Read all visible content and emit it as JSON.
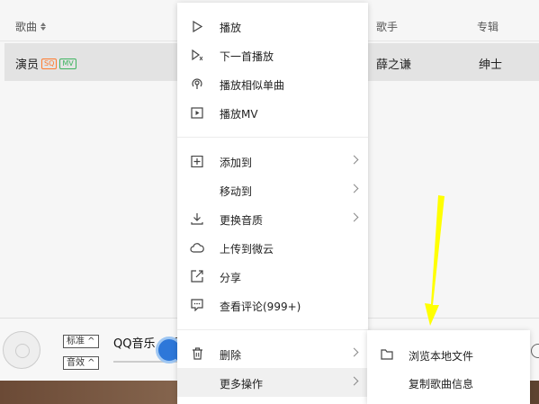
{
  "list": {
    "headers": {
      "song": "歌曲",
      "singer": "歌手",
      "album": "专辑"
    },
    "rows": [
      {
        "title": "演员",
        "badges": [
          "SQ",
          "MV"
        ],
        "singer": "薛之谦",
        "album": "绅士"
      }
    ]
  },
  "menu": {
    "items": [
      {
        "label": "播放",
        "icon": "play-icon"
      },
      {
        "label": "下一首播放",
        "icon": "play-next-icon"
      },
      {
        "label": "播放相似单曲",
        "icon": "radio-icon"
      },
      {
        "label": "播放MV",
        "icon": "mv-icon"
      },
      {
        "label": "添加到",
        "icon": "add-icon"
      },
      {
        "label": "移动到",
        "icon": ""
      },
      {
        "label": "更换音质",
        "icon": "download-icon"
      },
      {
        "label": "上传到微云",
        "icon": "cloud-icon"
      },
      {
        "label": "分享",
        "icon": "share-icon"
      },
      {
        "label": "查看评论(999+)",
        "icon": "comment-icon"
      },
      {
        "label": "删除",
        "icon": "trash-icon"
      },
      {
        "label": "更多操作",
        "icon": ""
      }
    ]
  },
  "submenu": {
    "items": [
      {
        "label": "浏览本地文件",
        "icon": "folder-icon"
      },
      {
        "label": "复制歌曲信息",
        "icon": ""
      }
    ]
  },
  "player": {
    "quality_label": "标准",
    "effect_label": "音效",
    "title": "QQ音乐，听"
  },
  "colors": {
    "sq_badge": "#ff7a2e",
    "mv_badge": "#3fb460",
    "arrow_annotation": "#ffff00"
  }
}
